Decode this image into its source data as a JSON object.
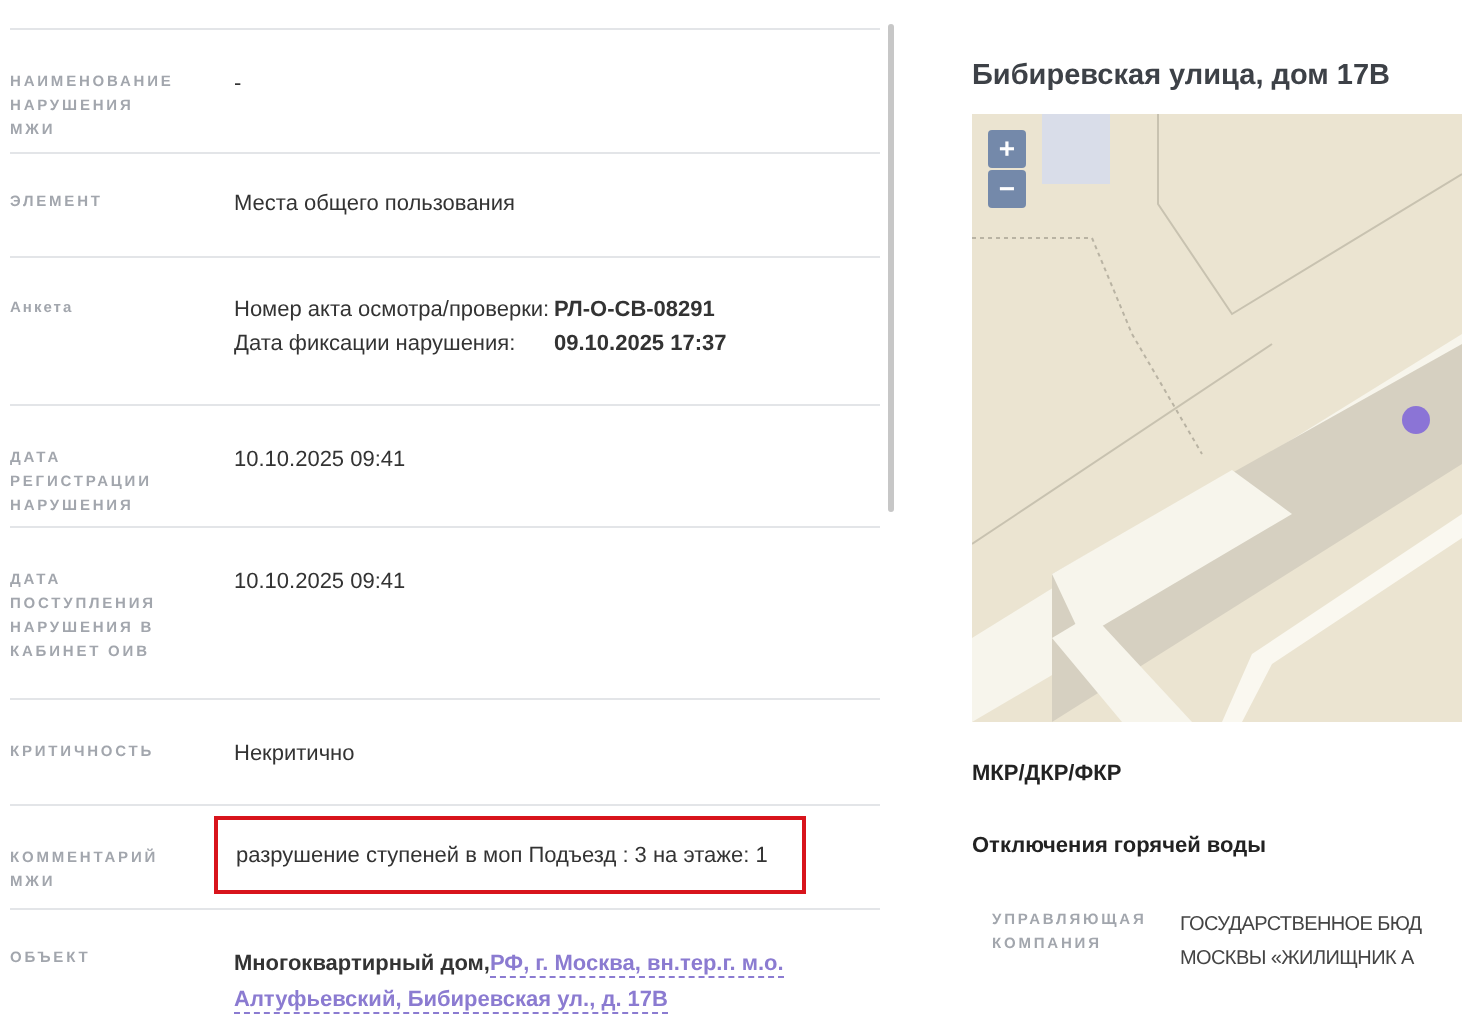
{
  "details": [
    {
      "kind": "text",
      "label": "НАИМЕНОВАНИЕ НАРУШЕНИЯ МЖИ",
      "value": "-"
    },
    {
      "kind": "text",
      "label": "ЭЛЕМЕНТ",
      "value": "Места общего пользования"
    },
    {
      "kind": "pairs",
      "label": "Анкета",
      "pairs": [
        {
          "key": "Номер акта осмотра/проверки:",
          "value": "РЛ-О-СВ-08291"
        },
        {
          "key": "Дата фиксации нарушения:",
          "value": "09.10.2025 17:37"
        }
      ]
    },
    {
      "kind": "text",
      "label": "ДАТА РЕГИСТРАЦИИ НАРУШЕНИЯ",
      "value": "10.10.2025 09:41"
    },
    {
      "kind": "text",
      "label": "ДАТА ПОСТУПЛЕНИЯ НАРУШЕНИЯ В КАБИНЕТ ОИВ",
      "value": "10.10.2025 09:41"
    },
    {
      "kind": "text",
      "label": "КРИТИЧНОСТЬ",
      "value": "Некритично"
    },
    {
      "kind": "text",
      "label": "КОММЕНТАРИЙ МЖИ",
      "value": "разрушение ступеней в моп Подъезд : 3 на этаже: 1",
      "highlighted": true
    },
    {
      "kind": "object",
      "label": "ОБЪЕКТ",
      "prefix": "Многоквартирный дом,",
      "link_lines": [
        "РФ, г. Москва, вн.тер.г. м.о.",
        "Алтуфьевский, Бибиревская ул., д. 17В"
      ]
    }
  ],
  "address_panel": {
    "title": "Бибиревская улица, дом 17В",
    "map": {
      "zoom_in": "+",
      "zoom_out": "−"
    },
    "sections": [
      "МКР/ДКР/ФКР",
      "Отключения горячей воды"
    ],
    "management": {
      "label": "УПРАВЛЯЮЩАЯ КОМПАНИЯ",
      "value_lines": [
        "ГОСУДАРСТВЕННОЕ БЮД",
        "МОСКВЫ «ЖИЛИЩНИК А"
      ]
    }
  }
}
